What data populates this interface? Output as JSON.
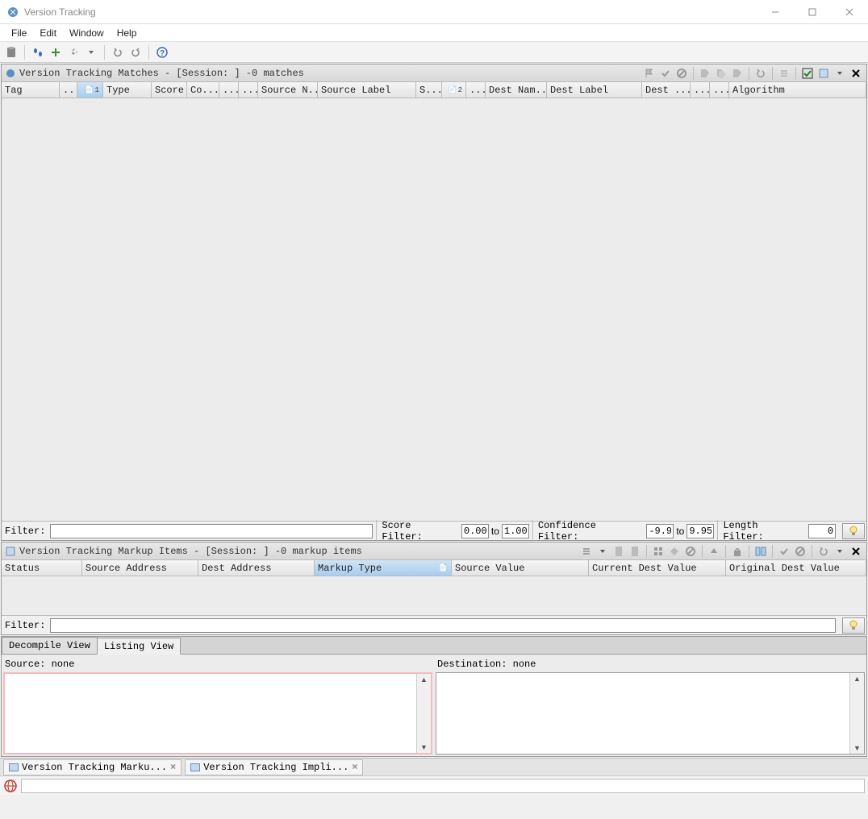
{
  "window": {
    "title": "Version Tracking"
  },
  "menu": {
    "file": "File",
    "edit": "Edit",
    "window": "Window",
    "help": "Help"
  },
  "matches_panel": {
    "title": "Version Tracking Matches - [Session: ] -0 matches",
    "columns": [
      "Tag",
      "...",
      "",
      "Type",
      "Score",
      "Co...",
      "...",
      "...",
      "Source N...",
      "Source Label",
      "S...",
      "",
      "...",
      "Dest Nam...",
      "Dest Label",
      "Dest ...",
      "...",
      "...",
      "Algorithm"
    ],
    "sort1": "1",
    "sort2": "2",
    "filter_label": "Filter:",
    "score_filter_label": "Score Filter:",
    "score_from": "0.00",
    "to": "to",
    "score_to": "1.00",
    "conf_filter_label": "Confidence Filter:",
    "conf_from": "-9.9",
    "conf_to": "9.95",
    "len_filter_label": "Length Filter:",
    "len_val": "0"
  },
  "markup_panel": {
    "title": "Version Tracking Markup Items - [Session: ] -0 markup items",
    "columns": [
      "Status",
      "Source Address",
      "Dest Address",
      "Markup Type",
      "Source Value",
      "Current Dest Value",
      "Original Dest Value"
    ],
    "filter_label": "Filter:"
  },
  "listing_tabs": {
    "decompile": "Decompile View",
    "listing": "Listing View"
  },
  "listing_area": {
    "source_label": "Source: none",
    "dest_label": "Destination: none"
  },
  "bottom_tabs": {
    "markup": "Version Tracking Marku...",
    "impli": "Version Tracking Impli..."
  }
}
